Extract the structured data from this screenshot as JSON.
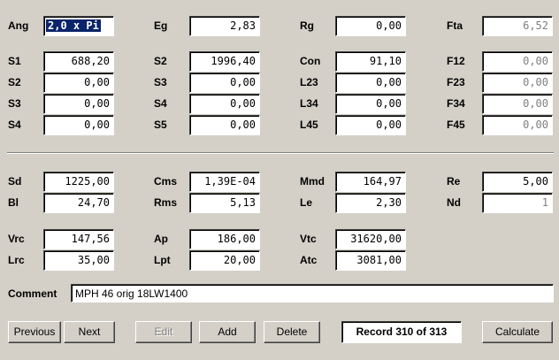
{
  "fields": {
    "ang": {
      "label": "Ang",
      "value": "2,0 x Pi"
    },
    "eg": {
      "label": "Eg",
      "value": "2,83"
    },
    "rg": {
      "label": "Rg",
      "value": "0,00"
    },
    "fta": {
      "label": "Fta",
      "value": "6,52"
    },
    "s1": {
      "label": "S1",
      "value": "688,20"
    },
    "s2a": {
      "label": "S2",
      "value": "1996,40"
    },
    "con": {
      "label": "Con",
      "value": "91,10"
    },
    "f12": {
      "label": "F12",
      "value": "0,00"
    },
    "s2b": {
      "label": "S2",
      "value": "0,00"
    },
    "s3a": {
      "label": "S3",
      "value": "0,00"
    },
    "l23": {
      "label": "L23",
      "value": "0,00"
    },
    "f23": {
      "label": "F23",
      "value": "0,00"
    },
    "s3b": {
      "label": "S3",
      "value": "0,00"
    },
    "s4a": {
      "label": "S4",
      "value": "0,00"
    },
    "l34": {
      "label": "L34",
      "value": "0,00"
    },
    "f34": {
      "label": "F34",
      "value": "0,00"
    },
    "s4b": {
      "label": "S4",
      "value": "0,00"
    },
    "s5": {
      "label": "S5",
      "value": "0,00"
    },
    "l45": {
      "label": "L45",
      "value": "0,00"
    },
    "f45": {
      "label": "F45",
      "value": "0,00"
    },
    "sd": {
      "label": "Sd",
      "value": "1225,00"
    },
    "cms": {
      "label": "Cms",
      "value": "1,39E-04"
    },
    "mmd": {
      "label": "Mmd",
      "value": "164,97"
    },
    "re": {
      "label": "Re",
      "value": "5,00"
    },
    "bl": {
      "label": "Bl",
      "value": "24,70"
    },
    "rms": {
      "label": "Rms",
      "value": "5,13"
    },
    "le": {
      "label": "Le",
      "value": "2,30"
    },
    "nd": {
      "label": "Nd",
      "value": "1"
    },
    "vrc": {
      "label": "Vrc",
      "value": "147,56"
    },
    "ap": {
      "label": "Ap",
      "value": "186,00"
    },
    "vtc": {
      "label": "Vtc",
      "value": "31620,00"
    },
    "lrc": {
      "label": "Lrc",
      "value": "35,00"
    },
    "lpt": {
      "label": "Lpt",
      "value": "20,00"
    },
    "atc": {
      "label": "Atc",
      "value": "3081,00"
    }
  },
  "comment": {
    "label": "Comment",
    "value": "MPH 46 orig 18LW1400"
  },
  "buttons": {
    "previous": "Previous",
    "next": "Next",
    "edit": "Edit",
    "add": "Add",
    "delete": "Delete",
    "calculate": "Calculate"
  },
  "record_status": "Record 310 of 313",
  "colors": {
    "background": "#d4d0c8",
    "selection": "#0a246a",
    "disabled_text": "#808080"
  }
}
